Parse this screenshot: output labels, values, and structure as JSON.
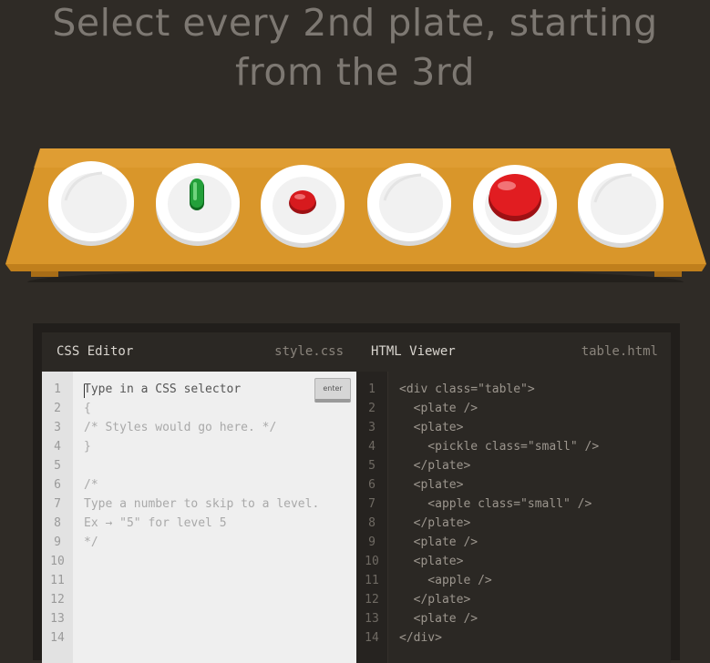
{
  "instruction": {
    "line1": "Select every 2nd plate, starting",
    "line2": "from the 3rd"
  },
  "table": {
    "items": [
      {
        "type": "plate",
        "contents": "none"
      },
      {
        "type": "plate",
        "contents": "pickle (small)"
      },
      {
        "type": "plate",
        "contents": "apple (small)"
      },
      {
        "type": "plate",
        "contents": "none"
      },
      {
        "type": "plate",
        "contents": "apple"
      },
      {
        "type": "plate",
        "contents": "none"
      }
    ]
  },
  "css_editor": {
    "title": "CSS Editor",
    "filename": "style.css",
    "enter_label": "enter",
    "input_placeholder": "Type in a CSS selector",
    "line_numbers": [
      "1",
      "2",
      "3",
      "4",
      "5",
      "6",
      "7",
      "8",
      "9",
      "10",
      "11",
      "12",
      "13",
      "14"
    ],
    "lines": [
      "Type in a CSS selector",
      "{",
      "/* Styles would go here. */",
      "}",
      "",
      "/*",
      "Type a number to skip to a level.",
      "Ex → \"5\" for level 5",
      "*/"
    ]
  },
  "html_viewer": {
    "title": "HTML Viewer",
    "filename": "table.html",
    "line_numbers": [
      "1",
      "2",
      "3",
      "4",
      "5",
      "6",
      "7",
      "8",
      "9",
      "10",
      "11",
      "12",
      "13",
      "14"
    ],
    "lines": [
      "<div class=\"table\">",
      "  <plate />",
      "  <plate>",
      "    <pickle class=\"small\" />",
      "  </plate>",
      "  <plate>",
      "    <apple class=\"small\" />",
      "  </plate>",
      "  <plate />",
      "  <plate>",
      "    <apple />",
      "  </plate>",
      "  <plate />",
      "</div>"
    ]
  },
  "colors": {
    "background": "#2f2b26",
    "table_wood": "#d9982e",
    "plate": "#ffffff",
    "apple": "#d4191d",
    "pickle": "#1f8d2e"
  }
}
